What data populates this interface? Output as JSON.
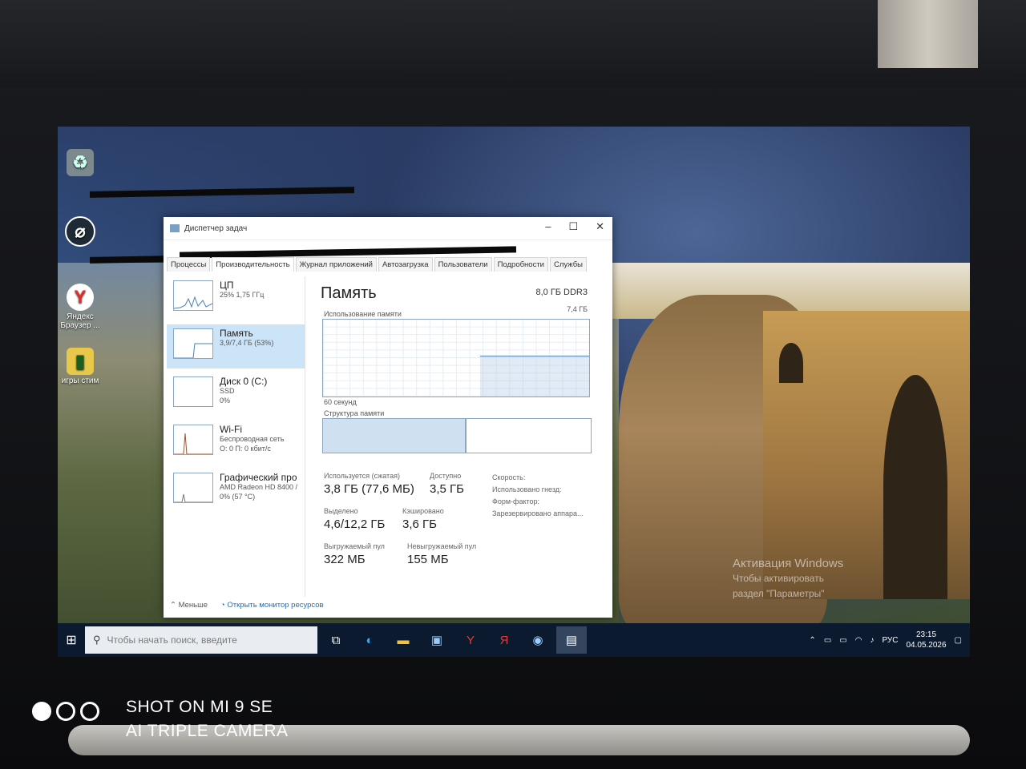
{
  "photo": {
    "camera_line1": "SHOT ON MI 9 SE",
    "camera_line2": "AI TRIPLE CAMERA"
  },
  "desktop": {
    "icons": [
      {
        "label": "",
        "icon": "recycle-bin-icon"
      },
      {
        "label": "",
        "icon": "app-circle-icon"
      },
      {
        "label": "Яндекс Браузер ...",
        "icon": "yandex-browser-icon"
      },
      {
        "label": "игры стим",
        "icon": "folder-games-icon"
      }
    ],
    "activation": {
      "line1": "Активация Windows",
      "line2": "Чтобы активировать",
      "line3": "раздел \"Параметры\""
    }
  },
  "task_manager": {
    "title": "Диспетчер задач",
    "window_buttons": [
      "–",
      "☐",
      "✕"
    ],
    "tabs": [
      "Процессы",
      "Производительность",
      "Журнал приложений",
      "Автозагрузка",
      "Пользователи",
      "Подробности",
      "Службы"
    ],
    "active_tab": "Производительность",
    "resources": [
      {
        "name": "ЦП",
        "sub1": "25% 1,75 ГГц",
        "sub2": ""
      },
      {
        "name": "Память",
        "sub1": "3,9/7,4 ГБ (53%)",
        "sub2": ""
      },
      {
        "name": "Диск 0 (C:)",
        "sub1": "SSD",
        "sub2": "0%"
      },
      {
        "name": "Wi-Fi",
        "sub1": "Беспроводная сеть",
        "sub2": "О: 0 П: 0 кбит/с"
      },
      {
        "name": "Графический про",
        "sub1": "AMD Radeon HD 8400 /",
        "sub2": "0% (57 °C)"
      }
    ],
    "memory": {
      "heading": "Память",
      "spec": "8,0 ГБ DDR3",
      "graph_max": "7,4 ГБ",
      "usage_label": "Использование памяти",
      "time_label": "60 секунд",
      "structure_label": "Структура памяти",
      "used_fraction": 0.53,
      "stats": [
        {
          "key": "Используется (сжатая)",
          "value": "3,8 ГБ (77,6 МБ)"
        },
        {
          "key": "Доступно",
          "value": "3,5 ГБ"
        },
        {
          "key": "Выделено",
          "value": "4,6/12,2 ГБ"
        },
        {
          "key": "Кэшировано",
          "value": "3,6 ГБ"
        },
        {
          "key": "Выгружаемый пул",
          "value": "322 МБ"
        },
        {
          "key": "Невыгружаемый пул",
          "value": "155 МБ"
        }
      ],
      "right_labels": [
        "Скорость:",
        "Использовано гнезд:",
        "Форм-фактор:",
        "Зарезервировано аппара..."
      ]
    },
    "footer": {
      "less": "Меньше",
      "monitor_link": "Открыть монитор ресурсов"
    }
  },
  "taskbar": {
    "search_placeholder": "Чтобы начать поиск, введите",
    "language": "РУС",
    "time": "23:15",
    "date": "04.05.2026"
  }
}
